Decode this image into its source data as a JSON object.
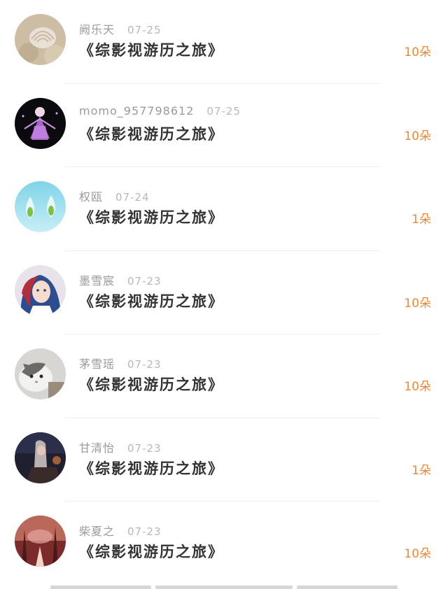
{
  "gift_list": [
    {
      "name": "阙乐天",
      "date": "07-25",
      "title": "《综影视游历之旅》",
      "amount": "10朵",
      "avatar_icon": "seashell-avatar-icon"
    },
    {
      "name": "momo_957798612",
      "date": "07-25",
      "title": "《综影视游历之旅》",
      "amount": "10朵",
      "avatar_icon": "purple-fairy-avatar-icon"
    },
    {
      "name": "权瓯",
      "date": "07-24",
      "title": "《综影视游历之旅》",
      "amount": "1朵",
      "avatar_icon": "water-drops-avatar-icon"
    },
    {
      "name": "墨雪宸",
      "date": "07-23",
      "title": "《综影视游历之旅》",
      "amount": "10朵",
      "avatar_icon": "anime-girl-avatar-icon"
    },
    {
      "name": "茅雪瑶",
      "date": "07-23",
      "title": "《综影视游历之旅》",
      "amount": "10朵",
      "avatar_icon": "cat-avatar-icon"
    },
    {
      "name": "甘清怡",
      "date": "07-23",
      "title": "《综影视游历之旅》",
      "amount": "1朵",
      "avatar_icon": "dark-figure-avatar-icon"
    },
    {
      "name": "柴夏之",
      "date": "07-23",
      "title": "《综影视游历之旅》",
      "amount": "10朵",
      "avatar_icon": "red-forest-avatar-icon"
    }
  ],
  "colors": {
    "amount": "#e8893d",
    "title": "#333333",
    "meta": "#9a9a9a"
  }
}
